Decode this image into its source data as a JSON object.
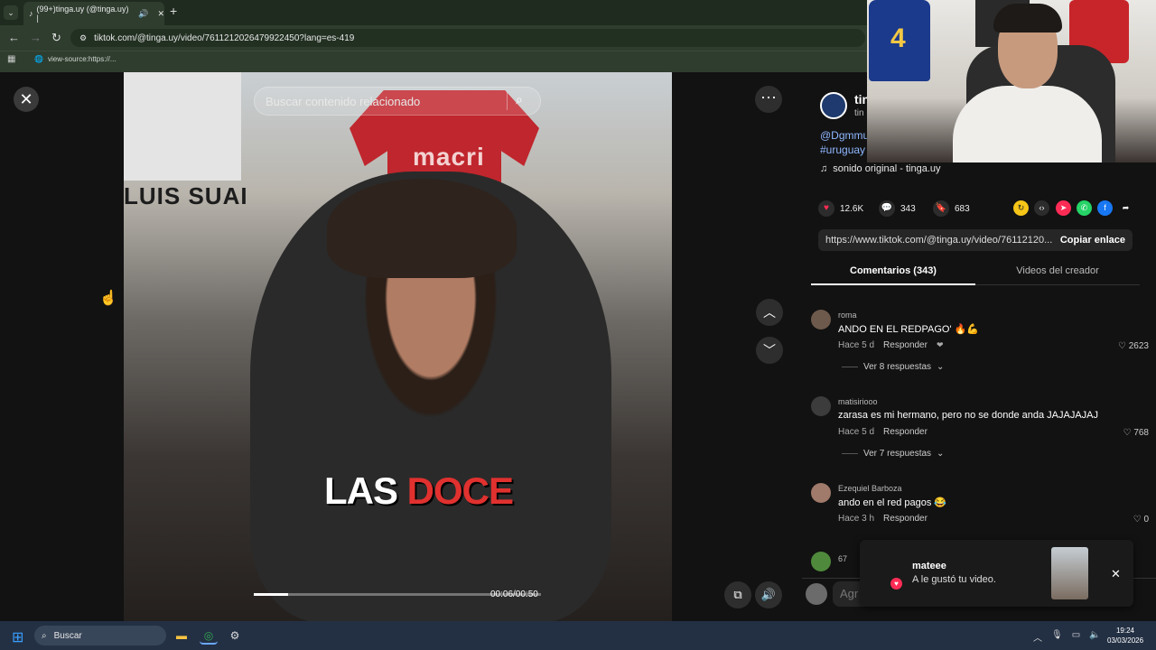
{
  "browser": {
    "tab_title": "(99+)tinga.uy (@tinga.uy) |",
    "url": "tiktok.com/@tinga.uy/video/7611212026479922450?lang=es-419",
    "bookmark": "view-source:https://..."
  },
  "video": {
    "search_placeholder": "Buscar contenido relacionado",
    "caption_white": "LAS",
    "caption_red": "DOCE",
    "jersey_text": "macri",
    "poster_text": "LUIS SUAI",
    "time": "00:06/00:50",
    "progress": 0.12
  },
  "author": {
    "name": "tin",
    "handle": "tin",
    "desc_line1": "@Dgmmu",
    "desc_line2": "#uruguay",
    "sound": "sonido original - tinga.uy"
  },
  "stats": {
    "likes": "12.6K",
    "comments": "343",
    "saves": "683"
  },
  "share": {
    "link": "https://www.tiktok.com/@tinga.uy/video/76112120...",
    "copy_label": "Copiar enlace"
  },
  "tabs": {
    "comments": "Comentarios (343)",
    "creator_videos": "Videos del creador"
  },
  "comments": [
    {
      "user": "roma",
      "text": "ANDO EN EL REDPAGO' 🔥💪",
      "time": "Hace 5 d",
      "reply": "Responder",
      "likes": "2623",
      "replies": "Ver 8 respuestas",
      "avatar_color": "#6e5a4c"
    },
    {
      "user": "matisiriooo",
      "text": "zarasa es mi hermano, pero no se donde anda JAJAJAJAJ",
      "time": "Hace 5 d",
      "reply": "Responder",
      "likes": "768",
      "replies": "Ver 7 respuestas",
      "avatar_color": "#3c3c3c"
    },
    {
      "user": "Ezequiel Barboza",
      "text": "ando en el red pagos 😂",
      "time": "Hace 3 h",
      "reply": "Responder",
      "likes": "0",
      "replies": "",
      "avatar_color": "#a07a6a"
    },
    {
      "user": "67",
      "avatar_color": "#4f8a3c"
    }
  ],
  "comment_input": {
    "placeholder": "Agr"
  },
  "notification": {
    "user": "mateee",
    "text": "A le gustó tu video."
  },
  "webcam": {
    "jersey_number": "4"
  },
  "taskbar": {
    "search": "Buscar",
    "time": "19:24",
    "date": "03/03/2026"
  }
}
